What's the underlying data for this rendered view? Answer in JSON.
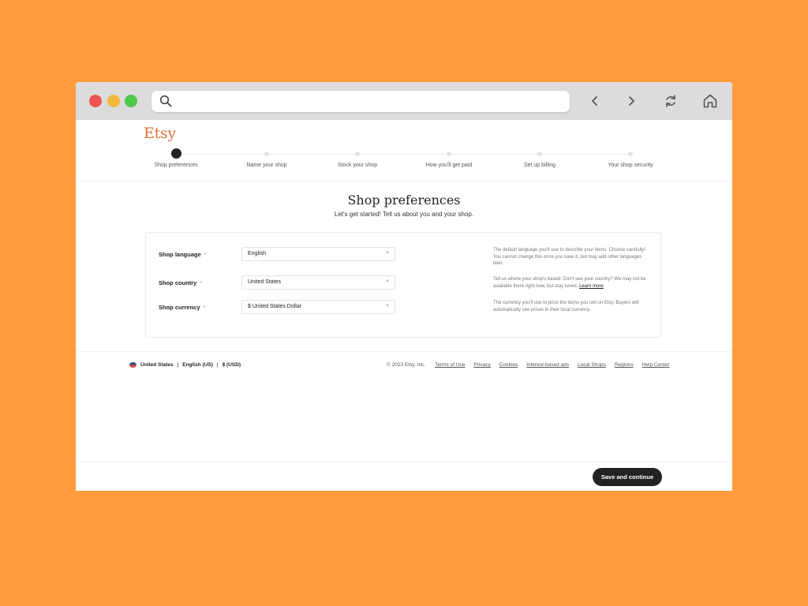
{
  "browser": {
    "address_value": "",
    "icons": [
      "search-icon",
      "back-icon",
      "forward-icon",
      "reload-icon",
      "home-icon"
    ]
  },
  "logo": "Etsy",
  "steps": [
    {
      "label": "Shop preferences",
      "active": true
    },
    {
      "label": "Name your shop",
      "active": false
    },
    {
      "label": "Stock your shop",
      "active": false
    },
    {
      "label": "How you'll get paid",
      "active": false
    },
    {
      "label": "Set up billing",
      "active": false
    },
    {
      "label": "Your shop security",
      "active": false
    }
  ],
  "main": {
    "title": "Shop preferences",
    "subtitle": "Let's get started! Tell us about you and your shop."
  },
  "form": {
    "required_mark": "*",
    "language": {
      "label": "Shop language",
      "value": "English",
      "help": "The default language you'll use to describe your items. Choose carefully! You cannot change this once you save it, but may add other languages later."
    },
    "country": {
      "label": "Shop country",
      "value": "United States",
      "help": "Tell us where your shop's based. Don't see your country? We may not be available there right now, but stay tuned.",
      "help_link": "Learn more"
    },
    "currency": {
      "label": "Shop currency",
      "value": "$ United States Dollar",
      "help": "The currency you'll use to price the items you sell on Etsy. Buyers will automatically see prices in their local currency."
    }
  },
  "footer": {
    "region": "United States",
    "language": "English (US)",
    "currency": "$ (USD)",
    "separator": "|",
    "copyright": "© 2023 Etsy, Inc.",
    "links": [
      "Terms of Use",
      "Privacy",
      "Cookies",
      "Interest-based ads",
      "Local Shops",
      "Regions",
      "Help Center"
    ]
  },
  "actions": {
    "save_label": "Save and continue"
  },
  "colors": {
    "background": "#FF9A3D",
    "brand": "#E0713A",
    "button": "#222222"
  }
}
